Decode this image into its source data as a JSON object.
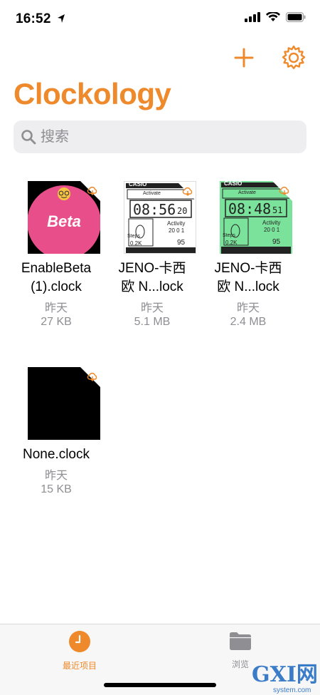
{
  "status_bar": {
    "time": "16:52"
  },
  "app": {
    "title": "Clockology",
    "accent": "#EE8A2B"
  },
  "search": {
    "placeholder": "搜索"
  },
  "files": [
    {
      "name_line1": "EnableBeta",
      "name_line2": "(1).clock",
      "date": "昨天",
      "size": "27 KB",
      "thumb": "beta",
      "badge_text": "Beta"
    },
    {
      "name_line1": "JENO-卡西",
      "name_line2": "欧 N...lock",
      "date": "昨天",
      "size": "5.1 MB",
      "thumb": "casio-white",
      "brand": "CASIO",
      "time_text": "08:56",
      "seconds": "20",
      "activity": "Activity",
      "activity_num": "20 0 1",
      "steps_label": "Steps",
      "steps": "0.2K",
      "hr": "95",
      "mode": "Activate"
    },
    {
      "name_line1": "JENO-卡西",
      "name_line2": "欧 N...lock",
      "date": "昨天",
      "size": "2.4 MB",
      "thumb": "casio-green",
      "brand": "CASIO",
      "time_text": "08:48",
      "seconds": "51",
      "activity": "Activity",
      "activity_num": "20 0 1",
      "steps_label": "Steps",
      "steps": "0.2K",
      "hr": "95",
      "mode": "Activate"
    },
    {
      "name_line1": "None.clock",
      "name_line2": "",
      "date": "昨天",
      "size": "15 KB",
      "thumb": "black"
    }
  ],
  "tabbar": {
    "recent": {
      "label": "最近项目",
      "active": true
    },
    "browse": {
      "label": "浏览",
      "active": false
    }
  },
  "watermark": {
    "big": "GXI网",
    "small": "system.com"
  }
}
